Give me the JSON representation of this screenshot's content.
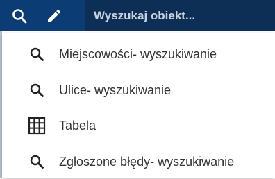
{
  "colors": {
    "toolbar_bg": "#0b3c73",
    "search_bg": "#0e2f55",
    "menu_text": "#333333",
    "icon_color": "#222222"
  },
  "toolbar": {
    "search_icon": "search-icon",
    "edit_icon": "pencil-icon"
  },
  "search": {
    "placeholder": "Wyszukaj obiekt...",
    "value": ""
  },
  "menu": {
    "items": [
      {
        "icon": "search-icon",
        "label": "Miejscowości- wyszukiwanie"
      },
      {
        "icon": "search-icon",
        "label": "Ulice- wyszukiwanie"
      },
      {
        "icon": "table-icon",
        "label": "Tabela"
      },
      {
        "icon": "search-icon",
        "label": "Zgłoszone błędy- wyszukiwanie"
      }
    ]
  }
}
